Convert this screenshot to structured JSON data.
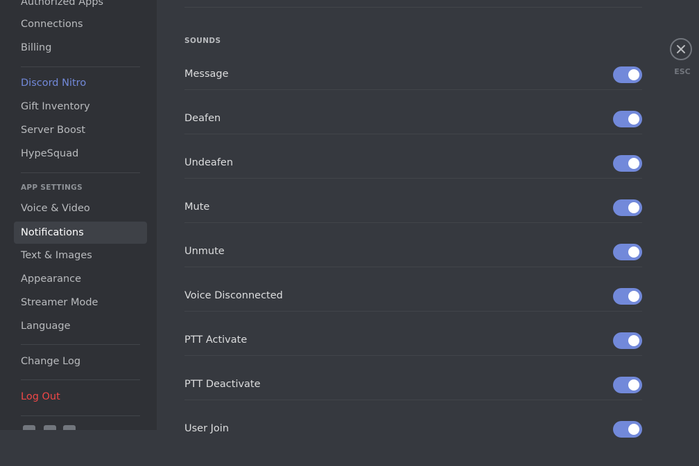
{
  "sidebar": {
    "items": [
      {
        "label": "Authorized Apps"
      },
      {
        "label": "Connections"
      },
      {
        "label": "Billing"
      },
      {
        "label": "Discord Nitro"
      },
      {
        "label": "Gift Inventory"
      },
      {
        "label": "Server Boost"
      },
      {
        "label": "HypeSquad"
      },
      {
        "label": "Voice & Video"
      },
      {
        "label": "Notifications"
      },
      {
        "label": "Text & Images"
      },
      {
        "label": "Appearance"
      },
      {
        "label": "Streamer Mode"
      },
      {
        "label": "Language"
      },
      {
        "label": "Change Log"
      },
      {
        "label": "Log Out"
      }
    ],
    "app_settings_header": "APP SETTINGS",
    "selected": "Notifications",
    "social_icons": [
      "twitter-icon",
      "facebook-icon",
      "instagram-icon"
    ]
  },
  "sounds": {
    "title": "SOUNDS",
    "items": [
      {
        "label": "Message",
        "enabled": true
      },
      {
        "label": "Deafen",
        "enabled": true
      },
      {
        "label": "Undeafen",
        "enabled": true
      },
      {
        "label": "Mute",
        "enabled": true
      },
      {
        "label": "Unmute",
        "enabled": true
      },
      {
        "label": "Voice Disconnected",
        "enabled": true
      },
      {
        "label": "PTT Activate",
        "enabled": true
      },
      {
        "label": "PTT Deactivate",
        "enabled": true
      },
      {
        "label": "User Join",
        "enabled": true
      }
    ]
  },
  "close": {
    "icon": "close-icon",
    "label": "ESC"
  },
  "colors": {
    "accent": "#7289da",
    "danger": "#f04747",
    "sidebar_bg": "#2f3136",
    "content_bg": "#36393f"
  }
}
